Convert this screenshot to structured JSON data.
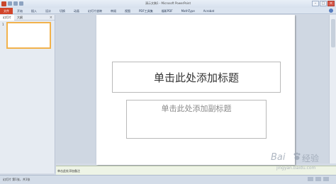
{
  "window": {
    "title": "演示文稿1 - Microsoft PowerPoint",
    "controls": [
      "–",
      "□",
      "×"
    ]
  },
  "ribbon": {
    "file_tab": "文件",
    "tabs": [
      "开始",
      "插入",
      "设计",
      "切换",
      "动画",
      "幻灯片放映",
      "审阅",
      "视图",
      "PDF工具集",
      "福昕PDF",
      "MathType",
      "Acrobat"
    ]
  },
  "left_pane": {
    "tabs": [
      "幻灯片",
      "大纲"
    ],
    "close_glyph": "×",
    "slide_number": "1"
  },
  "slide": {
    "title_placeholder": "单击此处添加标题",
    "subtitle_placeholder": "单击此处添加副标题"
  },
  "notes": {
    "placeholder": "单击此处添加备注"
  },
  "status": {
    "slide_info": "幻灯片 第1张，共1张"
  },
  "watermark": {
    "brand": "Bai",
    "brand_cn": "经验",
    "url": "jingyan.baidu.com"
  },
  "colors": {
    "file_tab": "#d2452a",
    "selection": "#f2b24c"
  }
}
